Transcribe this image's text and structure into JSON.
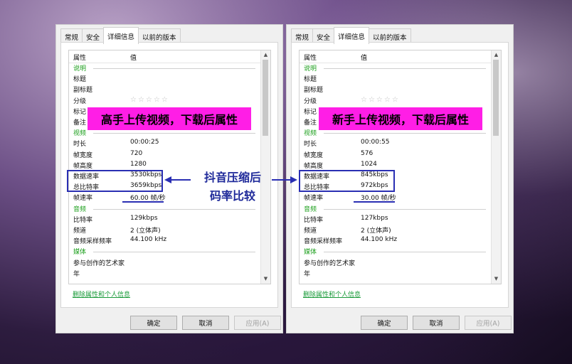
{
  "dialogs": [
    {
      "tabs": [
        "常规",
        "安全",
        "详细信息",
        "以前的版本"
      ],
      "active_tab": 2,
      "header": {
        "k": "属性",
        "v": "值"
      },
      "rows": [
        {
          "k": "说明",
          "v": "",
          "section": true
        },
        {
          "k": "标题",
          "v": ""
        },
        {
          "k": "副标题",
          "v": ""
        },
        {
          "k": "分级",
          "v": "☆☆☆☆☆",
          "stars": true
        },
        {
          "k": "标记",
          "v": ""
        },
        {
          "k": "备注",
          "v": ""
        },
        {
          "k": "视频",
          "v": "",
          "section": true
        },
        {
          "k": "时长",
          "v": "00:00:25"
        },
        {
          "k": "帧宽度",
          "v": "720"
        },
        {
          "k": "帧高度",
          "v": "1280"
        },
        {
          "k": "数据速率",
          "v": "3530kbps"
        },
        {
          "k": "总比特率",
          "v": "3659kbps"
        },
        {
          "k": "帧速率",
          "v": "60.00 帧/秒"
        },
        {
          "k": "音频",
          "v": "",
          "section": true
        },
        {
          "k": "比特率",
          "v": "129kbps"
        },
        {
          "k": "频道",
          "v": "2 (立体声)"
        },
        {
          "k": "音频采样频率",
          "v": "44.100 kHz"
        },
        {
          "k": "媒体",
          "v": "",
          "section": true
        },
        {
          "k": "参与创作的艺术家",
          "v": ""
        },
        {
          "k": "年",
          "v": ""
        }
      ],
      "remove_link": "删除属性和个人信息",
      "buttons": {
        "ok": "确定",
        "cancel": "取消",
        "apply": "应用(A)"
      },
      "banner": "高手上传视频，下载后属性"
    },
    {
      "tabs": [
        "常规",
        "安全",
        "详细信息",
        "以前的版本"
      ],
      "active_tab": 2,
      "header": {
        "k": "属性",
        "v": "值"
      },
      "rows": [
        {
          "k": "说明",
          "v": "",
          "section": true
        },
        {
          "k": "标题",
          "v": ""
        },
        {
          "k": "副标题",
          "v": ""
        },
        {
          "k": "分级",
          "v": "☆☆☆☆☆",
          "stars": true
        },
        {
          "k": "标记",
          "v": ""
        },
        {
          "k": "备注",
          "v": ""
        },
        {
          "k": "视频",
          "v": "",
          "section": true
        },
        {
          "k": "时长",
          "v": "00:00:55"
        },
        {
          "k": "帧宽度",
          "v": "576"
        },
        {
          "k": "帧高度",
          "v": "1024"
        },
        {
          "k": "数据速率",
          "v": "845kbps"
        },
        {
          "k": "总比特率",
          "v": "972kbps"
        },
        {
          "k": "帧速率",
          "v": "30.00 帧/秒"
        },
        {
          "k": "音频",
          "v": "",
          "section": true
        },
        {
          "k": "比特率",
          "v": "127kbps"
        },
        {
          "k": "频道",
          "v": "2 (立体声)"
        },
        {
          "k": "音频采样频率",
          "v": "44.100 kHz"
        },
        {
          "k": "媒体",
          "v": "",
          "section": true
        },
        {
          "k": "参与创作的艺术家",
          "v": ""
        },
        {
          "k": "年",
          "v": ""
        }
      ],
      "remove_link": "删除属性和个人信息",
      "buttons": {
        "ok": "确定",
        "cancel": "取消",
        "apply": "应用(A)"
      },
      "banner": "新手上传视频，下载后属性"
    }
  ],
  "annotation": {
    "line1": "抖音压缩后",
    "line2": "码率比较"
  },
  "colors": {
    "banner": "#ff1ee6",
    "highlight": "#2a2fb3",
    "section_text": "#1ea01e",
    "link": "#1a9b3a"
  },
  "icons": {
    "scroll_up": "chevron-up-icon",
    "scroll_down": "chevron-down-icon",
    "rating": "star-icon",
    "arrow": "arrow-icon"
  }
}
